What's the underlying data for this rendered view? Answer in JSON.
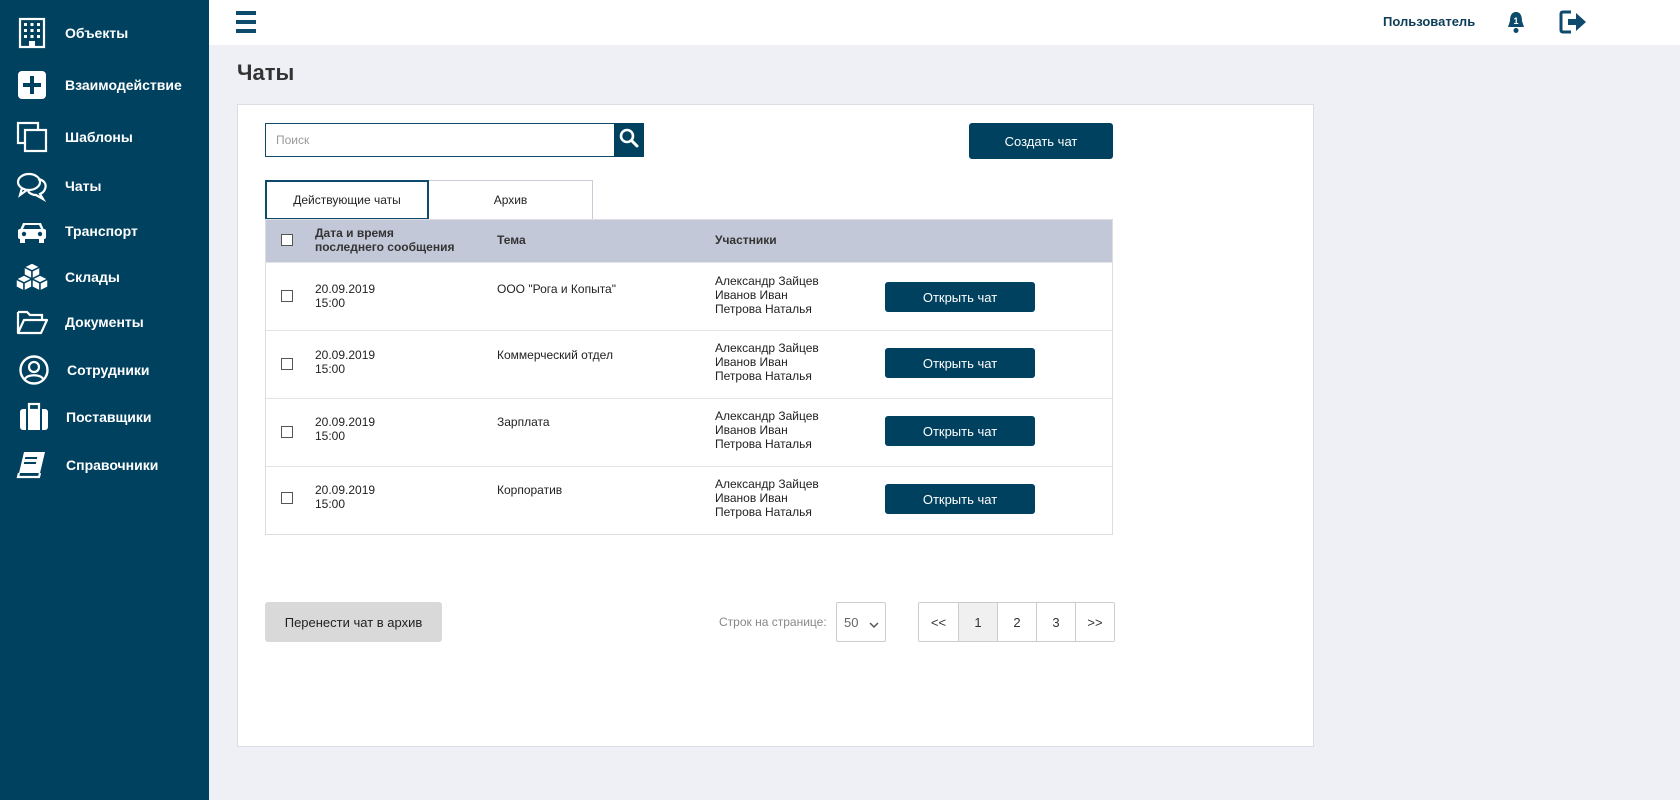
{
  "sidebar": {
    "items": [
      {
        "label": "Объекты",
        "icon": "building-icon"
      },
      {
        "label": "Взаимодействие",
        "icon": "plus-square-icon"
      },
      {
        "label": "Шаблоны",
        "icon": "copy-icon"
      },
      {
        "label": "Чаты",
        "icon": "chat-icon"
      },
      {
        "label": "Транспорт",
        "icon": "car-icon"
      },
      {
        "label": "Склады",
        "icon": "boxes-icon"
      },
      {
        "label": "Документы",
        "icon": "folder-open-icon"
      },
      {
        "label": "Сотрудники",
        "icon": "user-circle-icon"
      },
      {
        "label": "Поставщики",
        "icon": "briefcase-icon"
      },
      {
        "label": "Справочники",
        "icon": "book-icon"
      }
    ]
  },
  "header": {
    "user_label": "Пользователь",
    "notification_count": "1"
  },
  "page": {
    "title": "Чаты"
  },
  "search": {
    "placeholder": "Поиск"
  },
  "actions": {
    "create_chat": "Создать чат",
    "move_to_archive": "Перенести чат в архив"
  },
  "tabs": {
    "active": "Действующие чаты",
    "archive": "Архив"
  },
  "table": {
    "headers": {
      "date_line1": "Дата и время",
      "date_line2": "последнего сообщения",
      "topic": "Тема",
      "members": "Участники"
    },
    "open_label": "Открыть чат",
    "rows": [
      {
        "date": "20.09.2019",
        "time": "15:00",
        "topic": "ООО \"Рога и Копыта\"",
        "members": [
          "Александр Зайцев",
          "Иванов Иван",
          "Петрова Наталья"
        ]
      },
      {
        "date": "20.09.2019",
        "time": "15:00",
        "topic": "Коммерческий отдел",
        "members": [
          "Александр Зайцев",
          "Иванов Иван",
          "Петрова Наталья"
        ]
      },
      {
        "date": "20.09.2019",
        "time": "15:00",
        "topic": "Зарплата",
        "members": [
          "Александр Зайцев",
          "Иванов Иван",
          "Петрова Наталья"
        ]
      },
      {
        "date": "20.09.2019",
        "time": "15:00",
        "topic": "Корпоратив",
        "members": [
          "Александр Зайцев",
          "Иванов Иван",
          "Петрова Наталья"
        ]
      }
    ]
  },
  "pagination": {
    "rows_label": "Строк на странице:",
    "rows_value": "50",
    "first": "<<",
    "pages": [
      "1",
      "2",
      "3"
    ],
    "last": ">>",
    "current": "1"
  },
  "colors": {
    "sidebar_bg": "#00415f",
    "accent": "#00415f",
    "table_header_bg": "#c3c8d8",
    "page_bg": "#eff0f6"
  }
}
